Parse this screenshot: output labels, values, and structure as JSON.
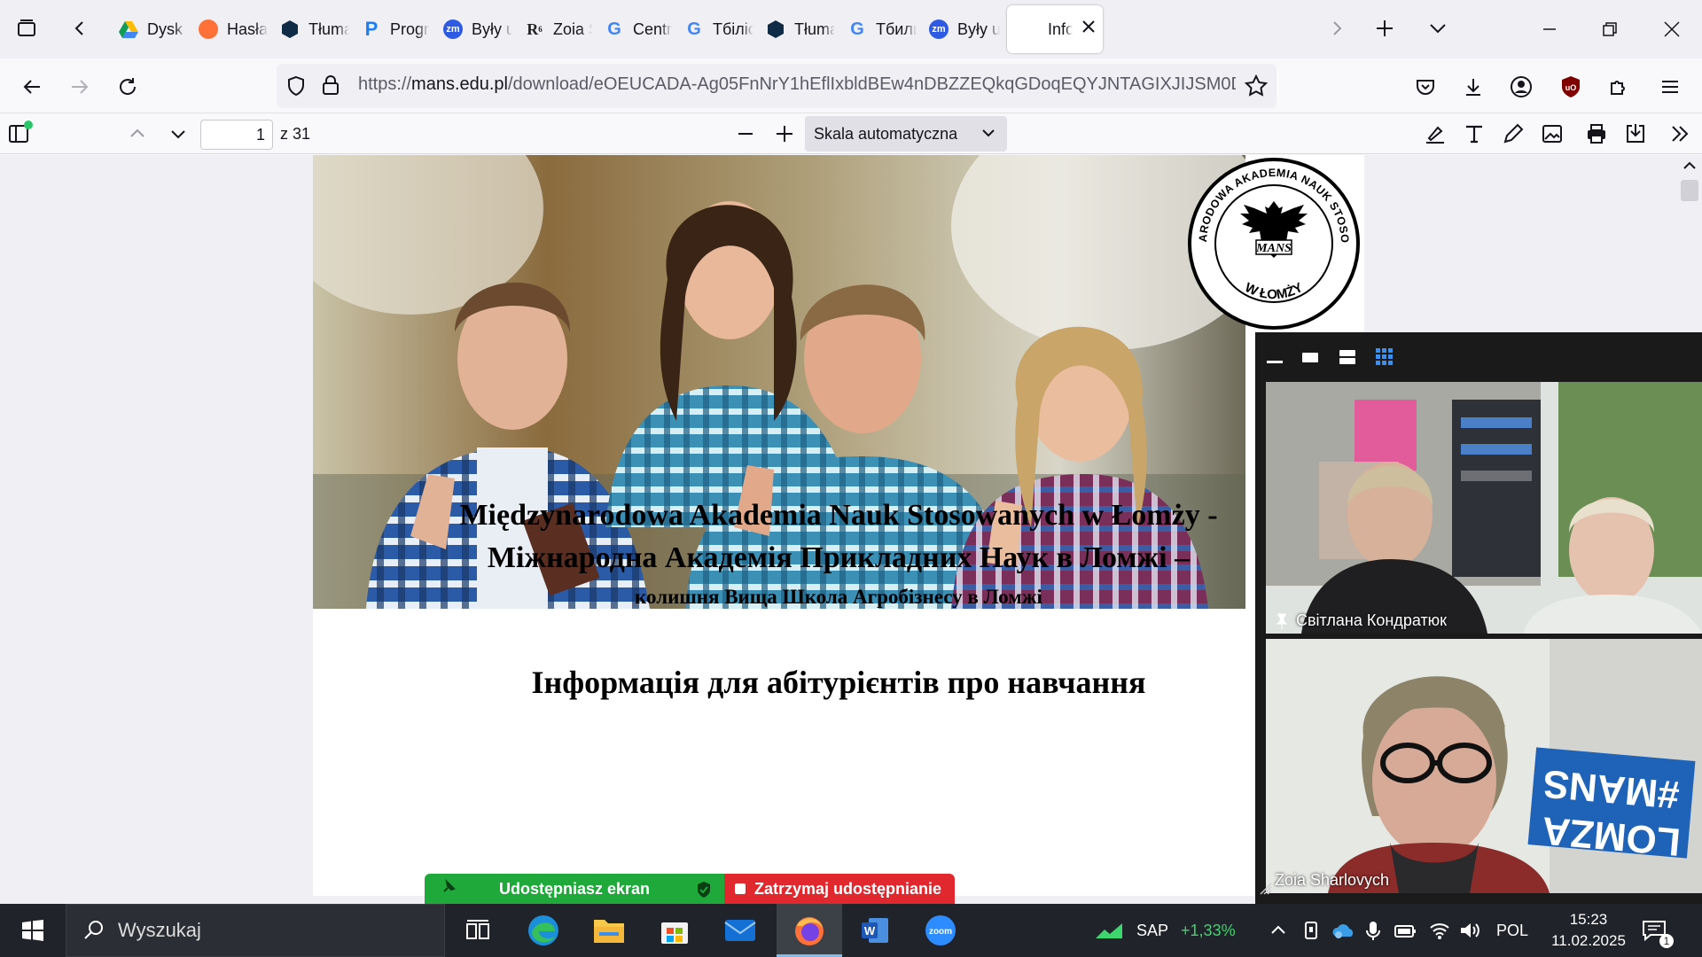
{
  "tabs": [
    {
      "label": "Dysk G",
      "icon": "google-drive-icon",
      "color": "#1a73e8"
    },
    {
      "label": "Hasła",
      "icon": "firefox-icon",
      "color": "#ff7139"
    },
    {
      "label": "Tłumacz",
      "icon": "deepl-icon",
      "color": "#0f2b46"
    },
    {
      "label": "Progr",
      "icon": "p-logo-icon",
      "color": "#1d7ef6"
    },
    {
      "label": "Były u",
      "icon": "zm-icon",
      "color": "#2d5be3"
    },
    {
      "label": "Zoia S",
      "icon": "r6-icon",
      "color": "#222222"
    },
    {
      "label": "Centr",
      "icon": "google-icon",
      "color": "#4285f4"
    },
    {
      "label": "Тбіліс",
      "icon": "google-icon",
      "color": "#4285f4"
    },
    {
      "label": "Tłuma",
      "icon": "deepl-icon",
      "color": "#0f2b46"
    },
    {
      "label": "Тбили",
      "icon": "google-icon",
      "color": "#4285f4"
    },
    {
      "label": "Były u",
      "icon": "zm-icon",
      "color": "#2d5be3"
    },
    {
      "label": "Info",
      "icon": "blank-page-icon",
      "color": "#ffffff",
      "active": true
    }
  ],
  "nav": {
    "url_prefix": "https://",
    "url_domain": "mans.edu.pl",
    "url_path": "/download/eOEUCADA-Ag05FnNrY1hEflIxbldBEw4nDBZZEQkqGDoqEQYJNTAGIXJIJSM0D"
  },
  "pdf": {
    "page_current": "1",
    "page_total": "z 31",
    "zoom": "Skala automatyczna"
  },
  "doc": {
    "seal_top": "MIĘDZYNARODOWA AKADEMIA NAUK STOSOWANYCH",
    "seal_bottom": "W ŁOMŻY",
    "seal_center": "MANS",
    "title_pl": "Międzynarodowa Akademia Nauk Stosowanych w Łomży -",
    "title_uk": "Міжнародна Академія Прикладних Наук в Ломжі –",
    "subtitle": "колишня Вища Школа Агробізнесу в Ломжі",
    "heading": "Інформація для абітурієнтів про навчання"
  },
  "share": {
    "sharing_label": "Udostępniasz ekran",
    "stop_label": "Zatrzymaj udostępnianie"
  },
  "gallery": {
    "tiles": [
      {
        "name": "Світлана Кондратюк",
        "pinned": true
      },
      {
        "name": "Zoia Sharlovych",
        "pinned": false
      }
    ],
    "banner_text_1": "#MANS",
    "banner_text_2": "LOMZA"
  },
  "taskbar": {
    "search_placeholder": "Wyszukaj",
    "stock_name": "SAP",
    "stock_change": "+1,33%",
    "language": "POL",
    "time": "15:23",
    "date": "11.02.2025",
    "notifications": "1"
  },
  "colors": {
    "share_green": "#1ea93a",
    "share_red": "#e0282e",
    "stock_green": "#3dd56d"
  }
}
